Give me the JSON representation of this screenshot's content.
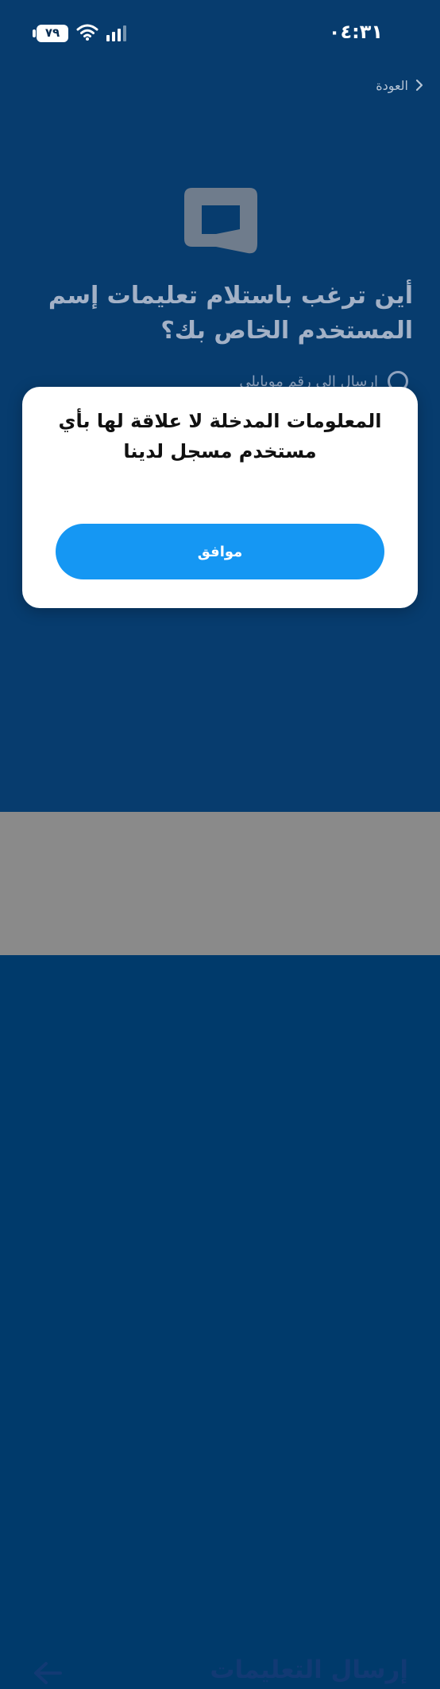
{
  "status_bar": {
    "time": "٠٤:٣١",
    "battery_level": "٧٩",
    "icons": [
      "wifi-icon",
      "signal-icon",
      "battery-icon"
    ]
  },
  "header": {
    "back_label": "العودة",
    "back_icon": "chevron-left-icon"
  },
  "main": {
    "logo_icon": "brand-logo",
    "heading": "أين ترغب باستلام تعليمات إسم المستخدم الخاص بك؟",
    "options": [
      {
        "label": "إرسال إلى رقم موبايلي",
        "selected": false
      }
    ]
  },
  "modal": {
    "message": "المعلومات المدخلة  لا علاقة لها بأي مستخدم مسجل لدينا",
    "ok_label": "موافق"
  },
  "bottom_bar": {
    "title": "إرسال التعليمات",
    "action_icon": "arrow-left-icon"
  },
  "colors": {
    "background": "#073c6e",
    "primary_button": "#1597f3",
    "dim_overlay": "#8a8a8a",
    "bottom_title": "#123a74"
  }
}
